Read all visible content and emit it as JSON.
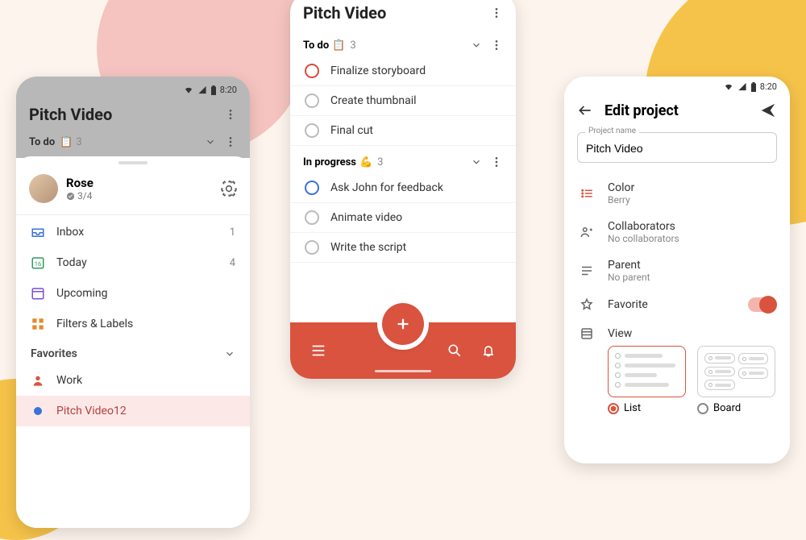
{
  "status": {
    "time": "8:20"
  },
  "left": {
    "title": "Pitch Video",
    "section": {
      "label": "To do",
      "emoji": "📋",
      "count": "3"
    },
    "user": {
      "name": "Rose",
      "progress": "3/4"
    },
    "nav": {
      "inbox": {
        "label": "Inbox",
        "count": "1"
      },
      "today": {
        "label": "Today",
        "count": "4"
      },
      "upcoming": {
        "label": "Upcoming"
      },
      "filters": {
        "label": "Filters & Labels"
      }
    },
    "fav": {
      "header": "Favorites",
      "work": {
        "label": "Work"
      },
      "pitch": {
        "label": "Pitch Video",
        "count": "12"
      }
    }
  },
  "center": {
    "title": "Pitch Video",
    "todo": {
      "label": "To do",
      "emoji": "📋",
      "count": "3"
    },
    "inprogress": {
      "label": "In progress",
      "emoji": "💪",
      "count": "3"
    },
    "tasks_todo": {
      "t1": "Finalize storyboard",
      "t2": "Create thumbnail",
      "t3": "Final cut"
    },
    "tasks_ip": {
      "t1": "Ask John for feedback",
      "t2": "Animate video",
      "t3": "Write the script"
    }
  },
  "right": {
    "title": "Edit project",
    "field": {
      "label": "Project name",
      "value": "Pitch Video"
    },
    "color": {
      "label": "Color",
      "value": "Berry"
    },
    "collab": {
      "label": "Collaborators",
      "value": "No collaborators"
    },
    "parent": {
      "label": "Parent",
      "value": "No parent"
    },
    "fav": {
      "label": "Favorite"
    },
    "view": {
      "label": "View",
      "list": "List",
      "board": "Board"
    }
  }
}
